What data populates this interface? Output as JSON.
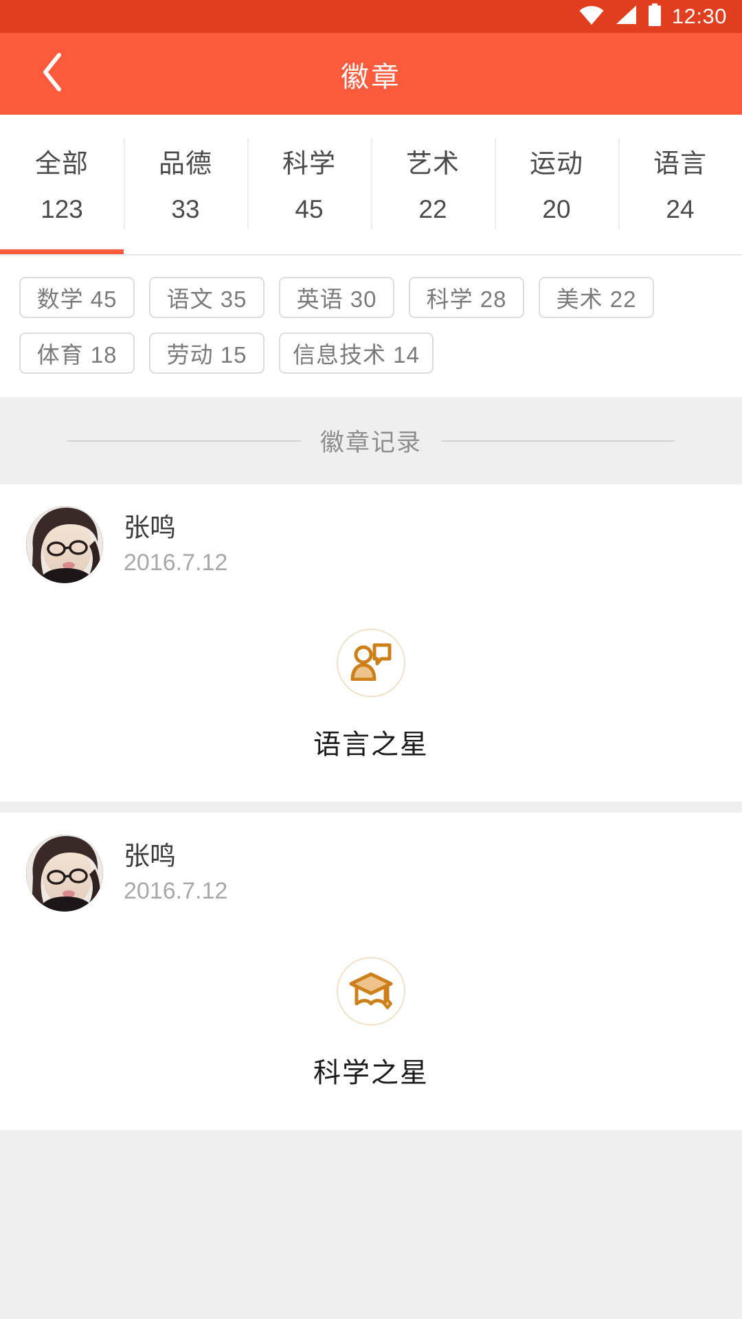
{
  "statusbar": {
    "time": "12:30",
    "icons": [
      "wifi-icon",
      "signal-icon",
      "battery-icon"
    ]
  },
  "header": {
    "title": "徽章",
    "back_icon": "chevron-left-icon",
    "bg_color": "#fb5a3c",
    "status_bg_color": "#e03e1e"
  },
  "tabs": [
    {
      "label": "全部",
      "count": "123",
      "active": true
    },
    {
      "label": "品德",
      "count": "33",
      "active": false
    },
    {
      "label": "科学",
      "count": "45",
      "active": false
    },
    {
      "label": "艺术",
      "count": "22",
      "active": false
    },
    {
      "label": "运动",
      "count": "20",
      "active": false
    },
    {
      "label": "语言",
      "count": "24",
      "active": false
    }
  ],
  "chips": [
    {
      "label": "数学 45"
    },
    {
      "label": "语文 35"
    },
    {
      "label": "英语 30"
    },
    {
      "label": "科学 28"
    },
    {
      "label": "美术 22"
    },
    {
      "label": "体育 18"
    },
    {
      "label": "劳动 15"
    },
    {
      "label": "信息技术 14"
    }
  ],
  "section": {
    "title": "徽章记录"
  },
  "records": [
    {
      "name": "张鸣",
      "date": "2016.7.12",
      "badge_name": "语言之星",
      "badge_icon": "person-speech-bubble-icon",
      "badge_color": "#cd7f1a"
    },
    {
      "name": "张鸣",
      "date": "2016.7.12",
      "badge_name": "科学之星",
      "badge_icon": "graduation-cap-icon",
      "badge_color": "#cd7f1a"
    }
  ]
}
